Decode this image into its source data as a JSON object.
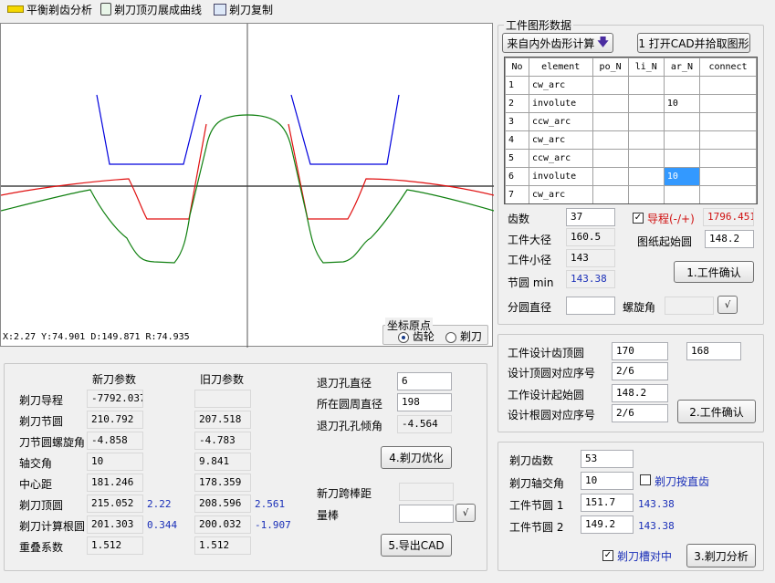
{
  "toolbar": {
    "item1": "平衡剃齿分析",
    "item2": "剃刀顶刃展成曲线",
    "item3": "剃刀复制"
  },
  "canvas": {
    "readout": "X:2.27  Y:74.901  D:149.871  R:74.935",
    "origin_title": "坐标原点",
    "origin_gear": "齿轮",
    "origin_cutter": "剃刀"
  },
  "workpiece": {
    "title": "工件图形数据",
    "calc_button": "来自内外齿形计算",
    "open_cad_button": "1 打开CAD并拾取图形",
    "table": {
      "headers": [
        "No",
        "element",
        "po_N",
        "li_N",
        "ar_N",
        "connect"
      ],
      "rows": [
        [
          "1",
          "cw_arc",
          "",
          "",
          "",
          ""
        ],
        [
          "2",
          "involute",
          "",
          "",
          "10",
          ""
        ],
        [
          "3",
          "ccw_arc",
          "",
          "",
          "",
          ""
        ],
        [
          "4",
          "cw_arc",
          "",
          "",
          "",
          ""
        ],
        [
          "5",
          "ccw_arc",
          "",
          "",
          "",
          ""
        ],
        [
          "6",
          "involute",
          "",
          "",
          "10",
          ""
        ],
        [
          "7",
          "cw_arc",
          "",
          "",
          "",
          ""
        ]
      ]
    },
    "teeth_label": "齿数",
    "teeth_value": "37",
    "lead_label": "导程(-/+)",
    "lead_value": "1796.451",
    "major_label": "工件大径",
    "major_value": "160.5",
    "start_circle_label": "图纸起始圆",
    "start_circle_value": "148.2",
    "minor_label": "工件小径",
    "minor_value": "143",
    "pitch_label": "节圆 min",
    "pitch_value": "143.38",
    "confirm1_button": "1.工件确认",
    "ref_dia_label": "分圆直径",
    "helix_label": "螺旋角"
  },
  "design": {
    "tip_label": "工件设计齿顶圆",
    "tip_value1": "170",
    "tip_value2": "168",
    "tip_seq_label": "设计顶圆对应序号",
    "tip_seq_value": "2/6",
    "start_label": "工作设计起始圆",
    "start_value": "148.2",
    "root_seq_label": "设计根圆对应序号",
    "root_seq_value": "2/6",
    "confirm2_button": "2.工件确认"
  },
  "cutter": {
    "teeth_label": "剃刀齿数",
    "teeth_value": "53",
    "axis_label": "剃刀轴交角",
    "axis_value": "10",
    "straight_label": "剃刀按直齿",
    "pitch1_label": "工件节圆 1",
    "pitch1_value": "151.7",
    "pitch1_note": "143.38",
    "pitch2_label": "工件节圆 2",
    "pitch2_value": "149.2",
    "pitch2_note": "143.38",
    "center_label": "剃刀槽对中",
    "analyze_button": "3.剃刀分析"
  },
  "params": {
    "new_header": "新刀参数",
    "old_header": "旧刀参数",
    "rows": [
      {
        "label": "剃刀导程",
        "new": "-7792.037",
        "new_extra": "",
        "old": "",
        "old_extra": ""
      },
      {
        "label": "剃刀节圆",
        "new": "210.792",
        "new_extra": "",
        "old": "207.518",
        "old_extra": ""
      },
      {
        "label": "刀节圆螺旋角",
        "new": "-4.858",
        "new_extra": "",
        "old": "-4.783",
        "old_extra": ""
      },
      {
        "label": "轴交角",
        "new": "10",
        "new_extra": "",
        "old": "9.841",
        "old_extra": ""
      },
      {
        "label": "中心距",
        "new": "181.246",
        "new_extra": "",
        "old": "178.359",
        "old_extra": ""
      },
      {
        "label": "剃刀顶圆",
        "new": "215.052",
        "new_extra": "2.22",
        "old": "208.596",
        "old_extra": "2.561"
      },
      {
        "label": "剃刀计算根圆",
        "new": "201.303",
        "new_extra": "0.344",
        "old": "200.032",
        "old_extra": "-1.907"
      },
      {
        "label": "重叠系数",
        "new": "1.512",
        "new_extra": "",
        "old": "1.512",
        "old_extra": ""
      }
    ]
  },
  "hole": {
    "hole_dia_label": "退刀孔直径",
    "hole_dia_value": "6",
    "circle_dia_label": "所在圆周直径",
    "circle_dia_value": "198",
    "angle_label": "退刀孔孔倾角",
    "angle_value": "-4.564",
    "optimize_button": "4.剃刀优化",
    "span_label": "新刀跨棒距",
    "pin_label": "量棒",
    "export_button": "5.导出CAD"
  },
  "colors": {
    "blue_profile": "#0000dd",
    "red_profile": "#e01010",
    "green_profile": "#108010"
  }
}
